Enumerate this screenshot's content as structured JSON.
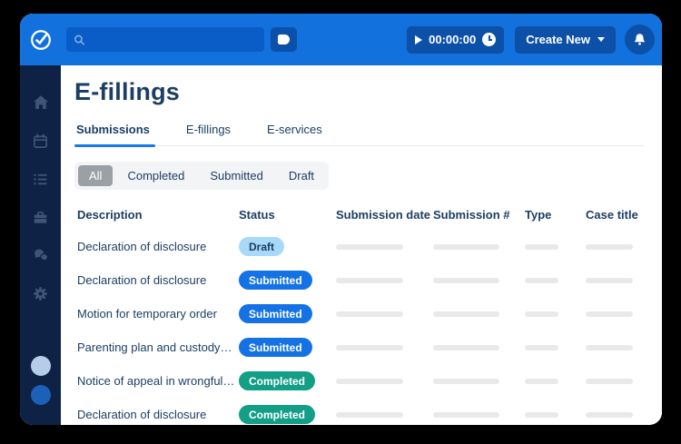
{
  "colors": {
    "topbar_blue": "#1271dd",
    "button_dark_blue": "#0c50a8",
    "sidebar_navy": "#0d2244",
    "text_navy": "#1c3e63",
    "accent_blue": "#1778e8",
    "pill_draft_bg": "#a9d9f9",
    "pill_submitted_bg": "#1472e4",
    "pill_completed_bg": "#139e87"
  },
  "topbar": {
    "logo_icon": "check-circle-logo",
    "search": {
      "placeholder": "",
      "value": ""
    },
    "tag_button_icon": "tag-icon",
    "timer": {
      "time": "00:00:00",
      "play_icon": "play-icon",
      "clock_icon": "clock-icon"
    },
    "create_new_label": "Create New",
    "bell_icon": "bell-icon"
  },
  "sidebar": {
    "items": [
      {
        "icon": "home-icon"
      },
      {
        "icon": "calendar-icon"
      },
      {
        "icon": "list-icon"
      },
      {
        "icon": "briefcase-icon"
      },
      {
        "icon": "chat-icon"
      },
      {
        "icon": "gear-icon"
      }
    ],
    "avatars": [
      {
        "name": "avatar-light"
      },
      {
        "name": "avatar-blue"
      }
    ]
  },
  "page": {
    "title": "E-fillings",
    "tabs": [
      {
        "label": "Submissions",
        "active": true
      },
      {
        "label": "E-fillings",
        "active": false
      },
      {
        "label": "E-services",
        "active": false
      }
    ],
    "filters": [
      {
        "label": "All",
        "selected": true
      },
      {
        "label": "Completed",
        "selected": false
      },
      {
        "label": "Submitted",
        "selected": false
      },
      {
        "label": "Draft",
        "selected": false
      }
    ],
    "table": {
      "columns": [
        "Description",
        "Status",
        "Submission date",
        "Submission #",
        "Type",
        "Case title"
      ],
      "rows": [
        {
          "description": "Declaration of disclosure",
          "status": "Draft"
        },
        {
          "description": "Declaration of disclosure",
          "status": "Submitted"
        },
        {
          "description": "Motion for temporary order",
          "status": "Submitted"
        },
        {
          "description": "Parenting plan and custody…",
          "status": "Submitted"
        },
        {
          "description": "Notice of appeal in wrongful…",
          "status": "Completed"
        },
        {
          "description": "Declaration of disclosure",
          "status": "Completed"
        }
      ]
    }
  }
}
